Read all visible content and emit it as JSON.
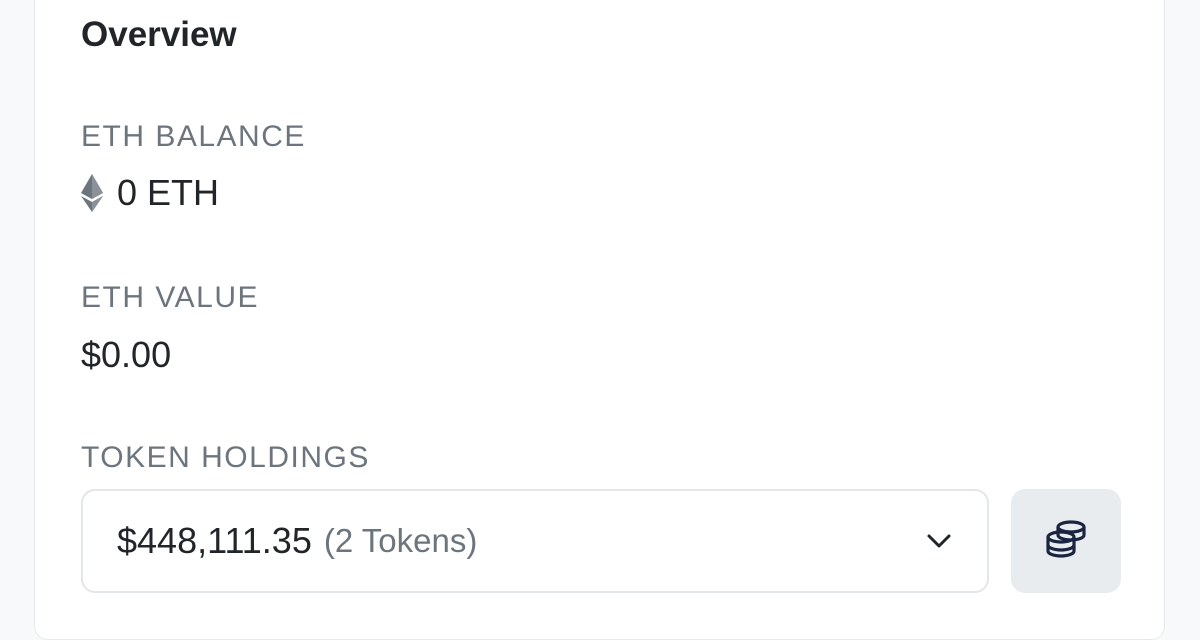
{
  "overview": {
    "title": "Overview"
  },
  "eth_balance": {
    "label": "ETH BALANCE",
    "value": "0 ETH",
    "icon": "ethereum-icon"
  },
  "eth_value": {
    "label": "ETH VALUE",
    "value": "$0.00"
  },
  "token_holdings": {
    "label": "TOKEN HOLDINGS",
    "amount": "$448,111.35",
    "count": "(2 Tokens)",
    "dropdown_icon": "chevron-down-icon",
    "button_icon": "coins-stack-icon"
  },
  "colors": {
    "text_primary": "#212529",
    "text_muted": "#6c757d",
    "border": "#e3e6ea",
    "button_bg": "#e9ecef",
    "icon_dark": "#1b2541"
  }
}
